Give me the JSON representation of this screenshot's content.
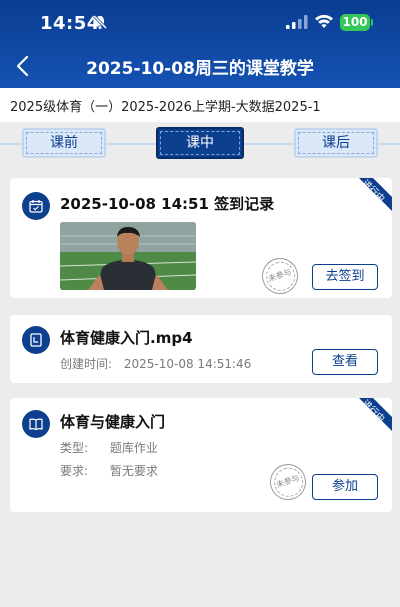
{
  "status_bar": {
    "time": "14:54",
    "battery": "100"
  },
  "header": {
    "title": "2025-10-08周三的课堂教学"
  },
  "course": {
    "text": "2025级体育（一）2025-2026上学期-大数据2025-1"
  },
  "tabs": [
    {
      "label": "课前",
      "active": false
    },
    {
      "label": "课中",
      "active": true
    },
    {
      "label": "课后",
      "active": false
    }
  ],
  "cards": [
    {
      "title": "2025-10-08 14:51  签到记录",
      "badge": "进行中",
      "stamp": "未参与",
      "button": "去签到",
      "icon": "calendar-icon",
      "image": "athlete-photo"
    },
    {
      "title": "体育健康入门.mp4",
      "meta_label": "创建时间:",
      "meta_value": "2025-10-08 14:51:46",
      "button": "查看",
      "icon": "document-icon"
    },
    {
      "title": "体育与健康入门",
      "badge": "进行中",
      "stamp": "未参与",
      "type_label": "类型:",
      "type_value": "题库作业",
      "require_label": "要求:",
      "require_value": "暂无要求",
      "button": "参加",
      "icon": "book-icon"
    }
  ],
  "colors": {
    "brand": "#0d3f8f",
    "header_top": "#0a3d91",
    "battery": "#34c759",
    "background": "#ececec"
  }
}
